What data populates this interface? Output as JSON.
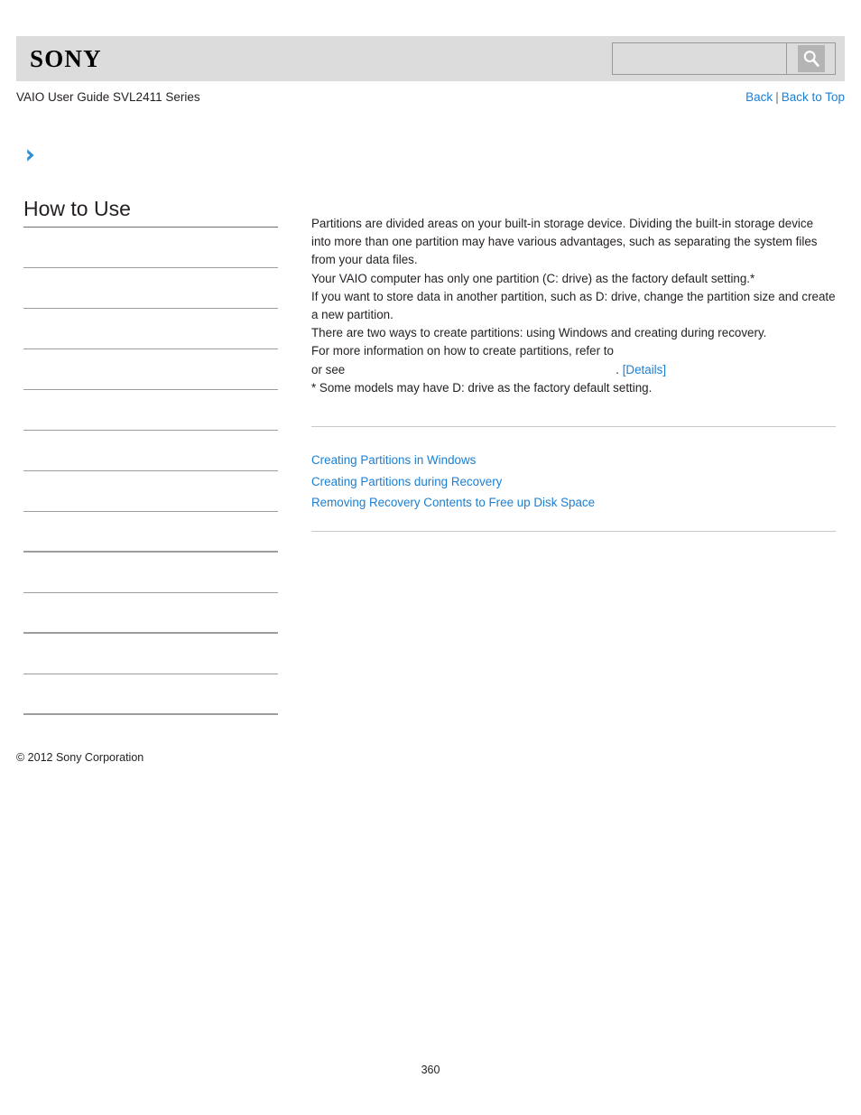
{
  "header": {
    "logo_text": "SONY",
    "search": {
      "value": "",
      "placeholder": "",
      "button_icon": "search-icon"
    }
  },
  "subheader": {
    "guide_title": "VAIO User Guide SVL2411 Series",
    "back_label": "Back",
    "separator": "|",
    "back_to_top_label": "Back to Top"
  },
  "breadcrumb": {
    "chevron_icon": "chevron-right-icon"
  },
  "sidebar": {
    "title": "How to Use",
    "items": [
      {
        "label": ""
      },
      {
        "label": ""
      },
      {
        "label": ""
      },
      {
        "label": ""
      },
      {
        "label": ""
      },
      {
        "label": ""
      },
      {
        "label": ""
      },
      {
        "label": ""
      },
      {
        "label": ""
      },
      {
        "label": ""
      },
      {
        "label": ""
      },
      {
        "label": ""
      },
      {
        "label": ""
      }
    ]
  },
  "content": {
    "paragraphs": [
      "Partitions are divided areas on your built-in storage device. Dividing the built-in storage device into more than one partition may have various advantages, such as separating the system files from your data files.",
      "Your VAIO computer has only one partition (C: drive) as the factory default setting.*",
      "If you want to store data in another partition, such as D: drive, change the partition size and create a new partition.",
      "There are two ways to create partitions: using Windows and creating during recovery.",
      "For more information on how to create partitions, refer to"
    ],
    "or_see_prefix": "or see",
    "or_see_period": ".",
    "details_label": "[Details]",
    "footnote": "* Some models may have D: drive as the factory default setting.",
    "related_links": [
      "Creating Partitions in Windows",
      "Creating Partitions during Recovery",
      "Removing Recovery Contents to Free up Disk Space"
    ]
  },
  "footer": {
    "copyright": "© 2012 Sony Corporation",
    "page_number": "360"
  },
  "colors": {
    "header_bg": "#dcdcdc",
    "link_blue": "#1a7fd4",
    "text": "#231f20",
    "rule_gray": "#c8c8c8"
  }
}
